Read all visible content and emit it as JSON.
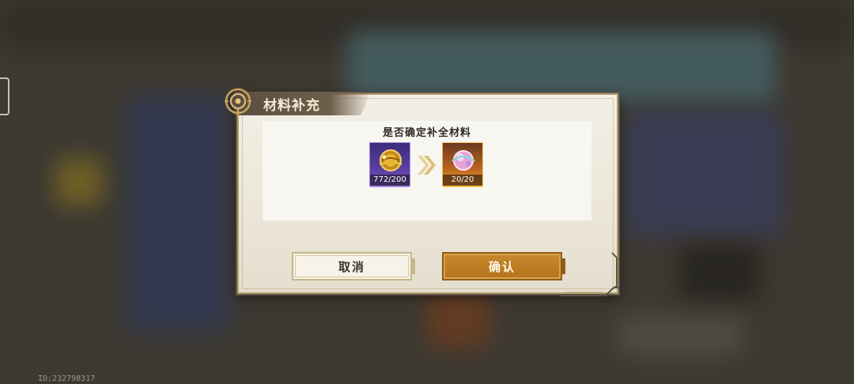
{
  "dialog": {
    "title": "材料补充",
    "question": "是否确定补全材料",
    "source_item": {
      "icon": "gold-coin-icon",
      "count": "772/200"
    },
    "target_item": {
      "icon": "pink-orb-icon",
      "count": "20/20"
    },
    "cancel_label": "取消",
    "confirm_label": "确认"
  },
  "footer": {
    "user_id": "ID:232798317"
  },
  "colors": {
    "accent_gold": "#b4731d",
    "frame": "#b59d6f",
    "source_rarity": "#5a3fa0",
    "target_rarity": "#e39a34"
  }
}
